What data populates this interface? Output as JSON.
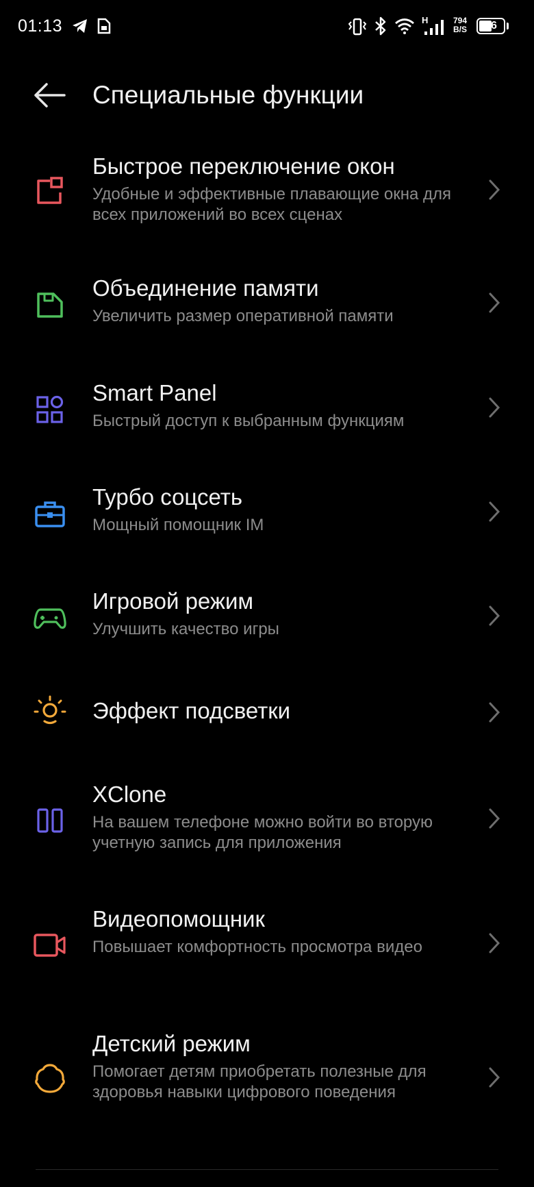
{
  "status_bar": {
    "time": "01:13",
    "network_speed_value": "794",
    "network_speed_unit": "B/S",
    "network_type": "H",
    "battery": "46",
    "icons": [
      "telegram-icon",
      "sim-card-icon",
      "vibrate-icon",
      "bluetooth-icon",
      "wifi-icon",
      "signal-icon",
      "battery-icon"
    ]
  },
  "header": {
    "title": "Специальные функции",
    "back_icon": "arrow-left-icon"
  },
  "items": [
    {
      "title": "Быстрое переключение окон",
      "subtitle": "Удобные и эффективные плавающие окна для всех приложений во всех сценах",
      "icon": "floating-window-icon",
      "color": "#e8575e"
    },
    {
      "title": "Объединение памяти",
      "subtitle": "Увеличить размер оперативной памяти",
      "icon": "memory-card-icon",
      "color": "#4fbf5c"
    },
    {
      "title": "Smart Panel",
      "subtitle": "Быстрый доступ к выбранным функциям",
      "icon": "grid-panel-icon",
      "color": "#6b62e8"
    },
    {
      "title": "Турбо соцсеть",
      "subtitle": "Мощный помощник IM",
      "icon": "toolbox-icon",
      "color": "#3a8ff0"
    },
    {
      "title": "Игровой режим",
      "subtitle": "Улучшить качество игры",
      "icon": "gamepad-icon",
      "color": "#4fbf5c"
    },
    {
      "title": "Эффект подсветки",
      "subtitle": "",
      "icon": "light-bulb-icon",
      "color": "#f3a93a"
    },
    {
      "title": "XClone",
      "subtitle": "На вашем телефоне можно войти во вторую учетную запись для приложения",
      "icon": "dual-app-icon",
      "color": "#6b62e8"
    },
    {
      "title": "Видеопомощник",
      "subtitle": "Повышает комфортность просмотра видео",
      "icon": "video-camera-icon",
      "color": "#e8575e"
    },
    {
      "title": "Детский режим",
      "subtitle": "Помогает детям приобретать полезные для здоровья навыки цифрового поведения",
      "icon": "kid-face-icon",
      "color": "#f3a93a"
    }
  ]
}
